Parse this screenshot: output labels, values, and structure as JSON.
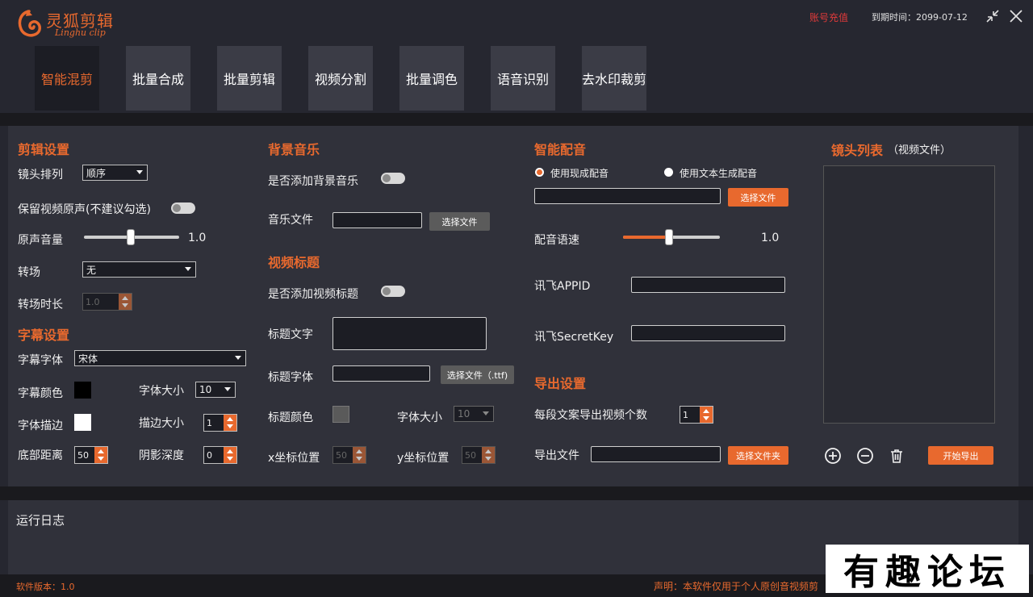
{
  "app": {
    "title_cn": "灵狐剪辑",
    "title_en": "Linghu clip",
    "recharge_label": "账号充值",
    "expire_text": "到期时间：2099-07-12",
    "brand_color": "#e8692e"
  },
  "tabs": [
    {
      "label": "智能混剪",
      "active": true
    },
    {
      "label": "批量合成",
      "active": false
    },
    {
      "label": "批量剪辑",
      "active": false
    },
    {
      "label": "视频分割",
      "active": false
    },
    {
      "label": "批量调色",
      "active": false
    },
    {
      "label": "语音识别",
      "active": false
    },
    {
      "label": "去水印裁剪",
      "active": false
    }
  ],
  "edit": {
    "title": "剪辑设置",
    "order_label": "镜头排列",
    "order_value": "顺序",
    "keep_audio_label": "保留视频原声(不建议勾选)",
    "keep_audio_on": false,
    "volume_label": "原声音量",
    "volume_value": "1.0",
    "volume_fraction": 0.5,
    "transition_label": "转场",
    "transition_value": "无",
    "transition_duration_label": "转场时长",
    "transition_duration_value": "1.0"
  },
  "subtitle": {
    "title": "字幕设置",
    "font_label": "字幕字体",
    "font_value": "宋体",
    "color_label": "字幕颜色",
    "color_value": "#000000",
    "font_size_label": "字体大小",
    "font_size_value": "10",
    "stroke_label": "字体描边",
    "stroke_color": "#ffffff",
    "stroke_size_label": "描边大小",
    "stroke_size_value": "1",
    "bottom_label": "底部距离",
    "bottom_value": "50",
    "shadow_label": "阴影深度",
    "shadow_value": "0"
  },
  "music": {
    "title": "背景音乐",
    "add_label": "是否添加背景音乐",
    "add_on": false,
    "file_label": "音乐文件",
    "file_button": "选择文件"
  },
  "video_title": {
    "title": "视频标题",
    "add_label": "是否添加视频标题",
    "add_on": false,
    "text_label": "标题文字",
    "font_label": "标题字体",
    "font_button": "选择文件（.ttf)",
    "color_label": "标题颜色",
    "color_value": "#5a5a5a",
    "size_label": "字体大小",
    "size_value": "10",
    "x_label": "x坐标位置",
    "x_value": "50",
    "y_label": "y坐标位置",
    "y_value": "50"
  },
  "dubbing": {
    "title": "智能配音",
    "option_existing": "使用现成配音",
    "option_tts": "使用文本生成配音",
    "selected": "existing",
    "file_button": "选择文件",
    "speed_label": "配音语速",
    "speed_value": "1.0",
    "speed_fraction": 0.5,
    "appid_label": "讯飞APPID",
    "secret_label": "讯飞SecretKey"
  },
  "export": {
    "title": "导出设置",
    "count_label": "每段文案导出视频个数",
    "count_value": "1",
    "file_label": "导出文件",
    "folder_button": "选择文件夹"
  },
  "shots": {
    "title": "镜头列表",
    "subtitle": "（视频文件）",
    "start_button": "开始导出"
  },
  "log": {
    "title": "运行日志"
  },
  "footer": {
    "version": "软件版本：1.0",
    "notice": "声明：本软件仅用于个人原创音视频剪"
  },
  "watermark": "有趣论坛"
}
